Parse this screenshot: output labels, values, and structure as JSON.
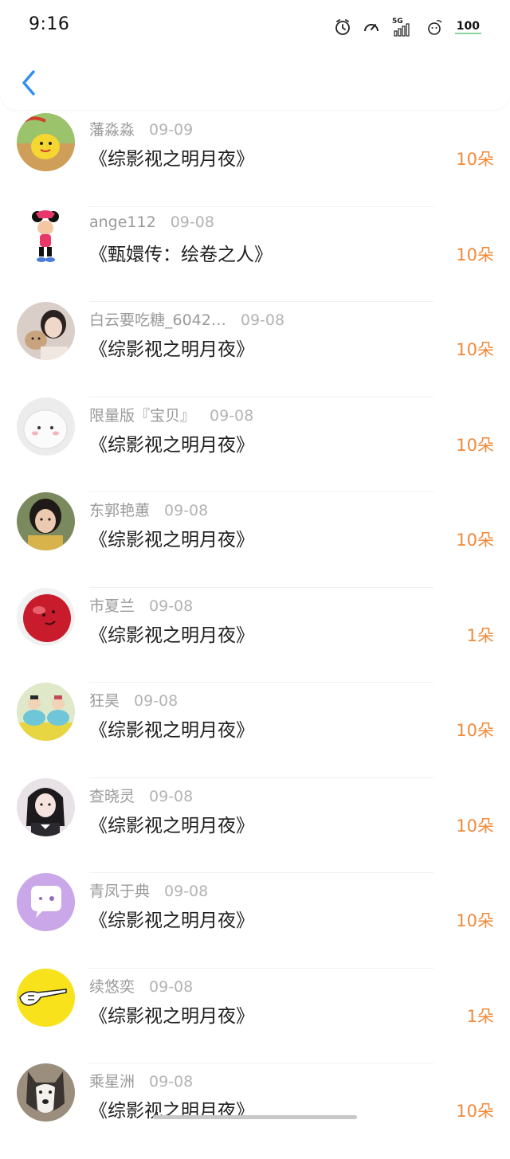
{
  "status_bar": {
    "time": "9:16",
    "network": "5G",
    "battery": "100"
  },
  "header": {
    "back_icon": "chevron-left-icon",
    "accent_color": "#2f8ef6"
  },
  "colors": {
    "amount": "#ef8a3a",
    "meta": "#9a9a9a"
  },
  "rows": [
    {
      "name": "藩淼淼",
      "date": "09-09",
      "title": "《综影视之明月夜》",
      "amount": "10朵",
      "avatar": "yellow-cat-cartoon"
    },
    {
      "name": "ange112",
      "date": "09-08",
      "title": "《甄嬛传：绘卷之人》",
      "amount": "10朵",
      "avatar": "minnie-mouse"
    },
    {
      "name": "白云要吃糖_6042…",
      "date": "09-08",
      "title": "《综影视之明月夜》",
      "amount": "10朵",
      "avatar": "girl-with-cat"
    },
    {
      "name": "限量版『宝贝』",
      "date": "09-08",
      "title": "《综影视之明月夜》",
      "amount": "10朵",
      "avatar": "white-plush"
    },
    {
      "name": "东郭艳蕙",
      "date": "09-08",
      "title": "《综影视之明月夜》",
      "amount": "10朵",
      "avatar": "girl-portrait"
    },
    {
      "name": "市夏兰",
      "date": "09-08",
      "title": "《综影视之明月夜》",
      "amount": "1朵",
      "avatar": "red-ball"
    },
    {
      "name": "狂昊",
      "date": "09-08",
      "title": "《综影视之明月夜》",
      "amount": "10朵",
      "avatar": "toy-figures"
    },
    {
      "name": "查晓灵",
      "date": "09-08",
      "title": "《综影视之明月夜》",
      "amount": "10朵",
      "avatar": "girl-in-uniform"
    },
    {
      "name": "青凤于典",
      "date": "09-08",
      "title": "《综影视之明月夜》",
      "amount": "10朵",
      "avatar": "purple-chat-bubble"
    },
    {
      "name": "续悠奕",
      "date": "09-08",
      "title": "《综影视之明月夜》",
      "amount": "1朵",
      "avatar": "yellow-hand-drawing"
    },
    {
      "name": "乘星洲",
      "date": "09-08",
      "title": "《综影视之明月夜》",
      "amount": "10朵",
      "avatar": "husky-dog"
    }
  ]
}
